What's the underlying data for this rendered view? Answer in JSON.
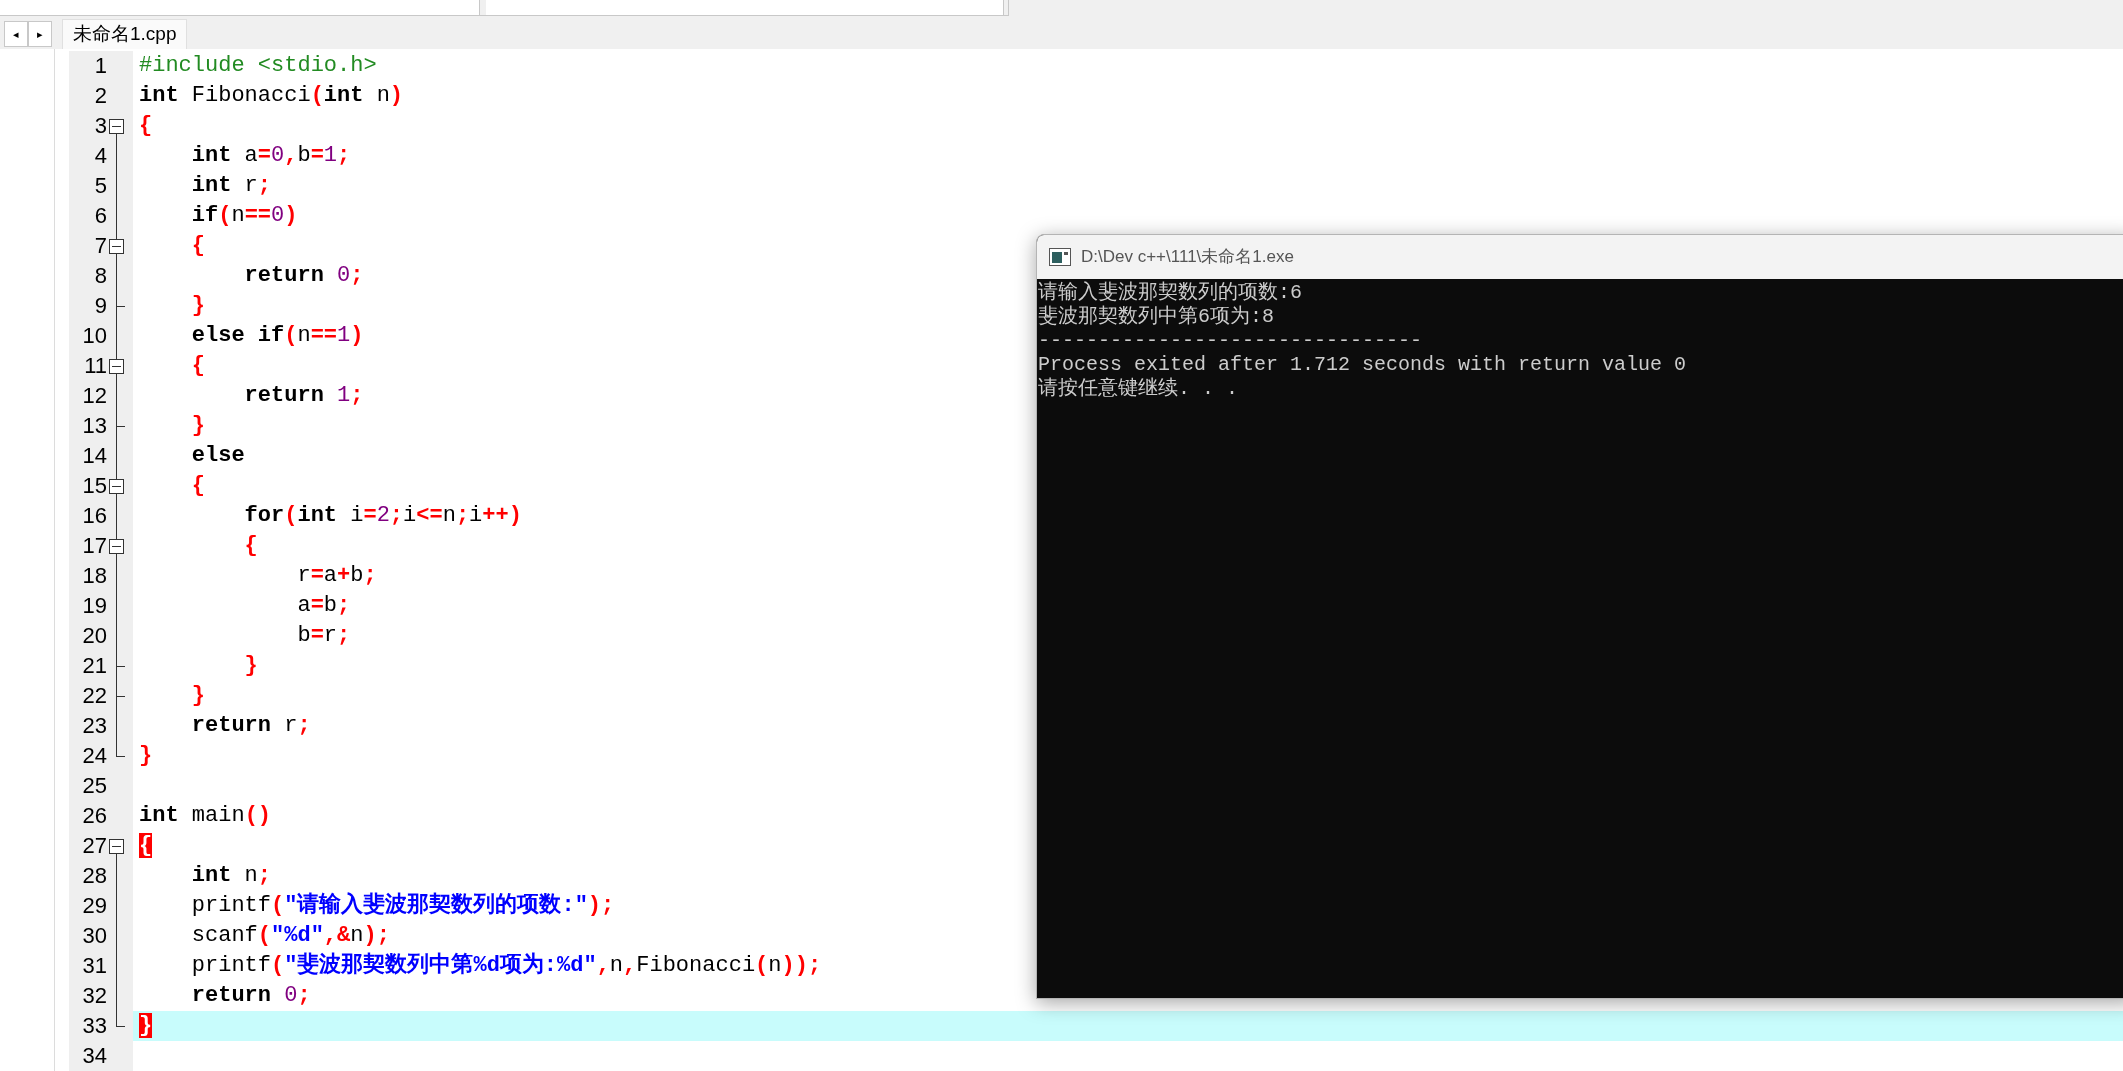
{
  "toolbar": {
    "dropdowns": [
      {
        "kind": "dropdown"
      },
      {
        "kind": "dropdown"
      }
    ]
  },
  "tab_bar": {
    "nav": [
      {
        "text": "◂"
      },
      {
        "text": "▸"
      }
    ],
    "tabs": [
      {
        "label": "未命名1.cpp",
        "selected": true
      }
    ]
  },
  "editor": {
    "lines": [
      {
        "number": "1",
        "current": false,
        "tokens": [
          {
            "kind": "pre",
            "text": "#include <stdio.h>"
          }
        ]
      },
      {
        "number": "2",
        "current": false,
        "tokens": [
          {
            "kind": "kw",
            "text": "int"
          },
          {
            "kind": "id",
            "text": " Fibonacci"
          },
          {
            "kind": "op",
            "text": "("
          },
          {
            "kind": "kw",
            "text": "int"
          },
          {
            "kind": "id",
            "text": " n"
          },
          {
            "kind": "op",
            "text": ")"
          }
        ]
      },
      {
        "number": "3",
        "fold": {
          "kind": "open"
        },
        "current": false,
        "tokens": [
          {
            "kind": "op",
            "text": "{"
          }
        ]
      },
      {
        "number": "4",
        "fold": {
          "kind": "bar"
        },
        "current": false,
        "tokens": [
          {
            "kind": "kw",
            "text": "    int"
          },
          {
            "kind": "id",
            "text": " a"
          },
          {
            "kind": "op",
            "text": "="
          },
          {
            "kind": "num",
            "text": "0"
          },
          {
            "kind": "op",
            "text": ","
          },
          {
            "kind": "id",
            "text": "b"
          },
          {
            "kind": "op",
            "text": "="
          },
          {
            "kind": "num",
            "text": "1"
          },
          {
            "kind": "op",
            "text": ";"
          }
        ]
      },
      {
        "number": "5",
        "fold": {
          "kind": "bar"
        },
        "current": false,
        "tokens": [
          {
            "kind": "kw",
            "text": "    int"
          },
          {
            "kind": "id",
            "text": " r"
          },
          {
            "kind": "op",
            "text": ";"
          }
        ]
      },
      {
        "number": "6",
        "fold": {
          "kind": "bar"
        },
        "current": false,
        "tokens": [
          {
            "kind": "kw",
            "text": "    if"
          },
          {
            "kind": "op",
            "text": "("
          },
          {
            "kind": "id",
            "text": "n"
          },
          {
            "kind": "op",
            "text": "=="
          },
          {
            "kind": "num",
            "text": "0"
          },
          {
            "kind": "op",
            "text": ")"
          }
        ]
      },
      {
        "number": "7",
        "fold": {
          "kind": "open"
        },
        "current": false,
        "tokens": [
          {
            "kind": "op",
            "text": "    {"
          }
        ]
      },
      {
        "number": "8",
        "fold": {
          "kind": "bar"
        },
        "current": false,
        "tokens": [
          {
            "kind": "kw",
            "text": "        return"
          },
          {
            "kind": "num",
            "text": " 0"
          },
          {
            "kind": "op",
            "text": ";"
          }
        ]
      },
      {
        "number": "9",
        "fold": {
          "kind": "tick"
        },
        "current": false,
        "tokens": [
          {
            "kind": "op",
            "text": "    }"
          }
        ]
      },
      {
        "number": "10",
        "fold": {
          "kind": "bar"
        },
        "current": false,
        "tokens": [
          {
            "kind": "kw",
            "text": "    else if"
          },
          {
            "kind": "op",
            "text": "("
          },
          {
            "kind": "id",
            "text": "n"
          },
          {
            "kind": "op",
            "text": "=="
          },
          {
            "kind": "num",
            "text": "1"
          },
          {
            "kind": "op",
            "text": ")"
          }
        ]
      },
      {
        "number": "11",
        "fold": {
          "kind": "open"
        },
        "current": false,
        "tokens": [
          {
            "kind": "op",
            "text": "    {"
          }
        ]
      },
      {
        "number": "12",
        "fold": {
          "kind": "bar"
        },
        "current": false,
        "tokens": [
          {
            "kind": "kw",
            "text": "        return"
          },
          {
            "kind": "num",
            "text": " 1"
          },
          {
            "kind": "op",
            "text": ";"
          }
        ]
      },
      {
        "number": "13",
        "fold": {
          "kind": "tick"
        },
        "current": false,
        "tokens": [
          {
            "kind": "op",
            "text": "    }"
          }
        ]
      },
      {
        "number": "14",
        "fold": {
          "kind": "bar"
        },
        "current": false,
        "tokens": [
          {
            "kind": "kw",
            "text": "    else"
          }
        ]
      },
      {
        "number": "15",
        "fold": {
          "kind": "open"
        },
        "current": false,
        "tokens": [
          {
            "kind": "op",
            "text": "    {"
          }
        ]
      },
      {
        "number": "16",
        "fold": {
          "kind": "bar"
        },
        "current": false,
        "tokens": [
          {
            "kind": "kw",
            "text": "        for"
          },
          {
            "kind": "op",
            "text": "("
          },
          {
            "kind": "kw",
            "text": "int"
          },
          {
            "kind": "id",
            "text": " i"
          },
          {
            "kind": "op",
            "text": "="
          },
          {
            "kind": "num",
            "text": "2"
          },
          {
            "kind": "op",
            "text": ";"
          },
          {
            "kind": "id",
            "text": "i"
          },
          {
            "kind": "op",
            "text": "<="
          },
          {
            "kind": "id",
            "text": "n"
          },
          {
            "kind": "op",
            "text": ";"
          },
          {
            "kind": "id",
            "text": "i"
          },
          {
            "kind": "op",
            "text": "++)"
          }
        ]
      },
      {
        "number": "17",
        "fold": {
          "kind": "open"
        },
        "current": false,
        "tokens": [
          {
            "kind": "op",
            "text": "        {"
          }
        ]
      },
      {
        "number": "18",
        "fold": {
          "kind": "bar"
        },
        "current": false,
        "tokens": [
          {
            "kind": "id",
            "text": "            r"
          },
          {
            "kind": "op",
            "text": "="
          },
          {
            "kind": "id",
            "text": "a"
          },
          {
            "kind": "op",
            "text": "+"
          },
          {
            "kind": "id",
            "text": "b"
          },
          {
            "kind": "op",
            "text": ";"
          }
        ]
      },
      {
        "number": "19",
        "fold": {
          "kind": "bar"
        },
        "current": false,
        "tokens": [
          {
            "kind": "id",
            "text": "            a"
          },
          {
            "kind": "op",
            "text": "="
          },
          {
            "kind": "id",
            "text": "b"
          },
          {
            "kind": "op",
            "text": ";"
          }
        ]
      },
      {
        "number": "20",
        "fold": {
          "kind": "bar"
        },
        "current": false,
        "tokens": [
          {
            "kind": "id",
            "text": "            b"
          },
          {
            "kind": "op",
            "text": "="
          },
          {
            "kind": "id",
            "text": "r"
          },
          {
            "kind": "op",
            "text": ";"
          }
        ]
      },
      {
        "number": "21",
        "fold": {
          "kind": "tick"
        },
        "current": false,
        "tokens": [
          {
            "kind": "op",
            "text": "        }"
          }
        ]
      },
      {
        "number": "22",
        "fold": {
          "kind": "tick"
        },
        "current": false,
        "tokens": [
          {
            "kind": "op",
            "text": "    }"
          }
        ]
      },
      {
        "number": "23",
        "fold": {
          "kind": "bar"
        },
        "current": false,
        "tokens": [
          {
            "kind": "kw",
            "text": "    return"
          },
          {
            "kind": "id",
            "text": " r"
          },
          {
            "kind": "op",
            "text": ";"
          }
        ]
      },
      {
        "number": "24",
        "fold": {
          "kind": "end"
        },
        "current": false,
        "tokens": [
          {
            "kind": "op",
            "text": "}"
          }
        ]
      },
      {
        "number": "25",
        "current": false
      },
      {
        "number": "26",
        "current": false,
        "tokens": [
          {
            "kind": "kw",
            "text": "int"
          },
          {
            "kind": "id",
            "text": " main"
          },
          {
            "kind": "op",
            "text": "()"
          }
        ]
      },
      {
        "number": "27",
        "fold": {
          "kind": "open"
        },
        "current": false,
        "tokens": [
          {
            "kind": "match",
            "text": "{"
          }
        ]
      },
      {
        "number": "28",
        "fold": {
          "kind": "bar"
        },
        "current": false,
        "tokens": [
          {
            "kind": "kw",
            "text": "    int"
          },
          {
            "kind": "id",
            "text": " n"
          },
          {
            "kind": "op",
            "text": ";"
          }
        ]
      },
      {
        "number": "29",
        "fold": {
          "kind": "bar"
        },
        "current": false,
        "tokens": [
          {
            "kind": "id",
            "text": "    printf"
          },
          {
            "kind": "op",
            "text": "("
          },
          {
            "kind": "str",
            "text": "\"请输入斐波那契数列的项数:\""
          },
          {
            "kind": "op",
            "text": ");"
          }
        ]
      },
      {
        "number": "30",
        "fold": {
          "kind": "bar"
        },
        "current": false,
        "tokens": [
          {
            "kind": "id",
            "text": "    scanf"
          },
          {
            "kind": "op",
            "text": "("
          },
          {
            "kind": "str",
            "text": "\"%d\""
          },
          {
            "kind": "op",
            "text": ",&"
          },
          {
            "kind": "id",
            "text": "n"
          },
          {
            "kind": "op",
            "text": ");"
          }
        ]
      },
      {
        "number": "31",
        "fold": {
          "kind": "bar"
        },
        "current": false,
        "tokens": [
          {
            "kind": "id",
            "text": "    printf"
          },
          {
            "kind": "op",
            "text": "("
          },
          {
            "kind": "str",
            "text": "\"斐波那契数列中第%d项为:%d\""
          },
          {
            "kind": "op",
            "text": ","
          },
          {
            "kind": "id",
            "text": "n"
          },
          {
            "kind": "op",
            "text": ","
          },
          {
            "kind": "id",
            "text": "Fibonacci"
          },
          {
            "kind": "op",
            "text": "("
          },
          {
            "kind": "id",
            "text": "n"
          },
          {
            "kind": "op",
            "text": "));"
          }
        ]
      },
      {
        "number": "32",
        "fold": {
          "kind": "bar"
        },
        "current": false,
        "tokens": [
          {
            "kind": "kw",
            "text": "    return"
          },
          {
            "kind": "num",
            "text": " 0"
          },
          {
            "kind": "op",
            "text": ";"
          }
        ]
      },
      {
        "number": "33",
        "fold": {
          "kind": "end"
        },
        "current": true,
        "tokens": [
          {
            "kind": "match",
            "text": "}"
          }
        ]
      },
      {
        "number": "34",
        "current": false
      }
    ]
  },
  "console": {
    "title": "D:\\Dev c++\\111\\未命名1.exe",
    "lines": [
      "请输入斐波那契数列的项数:6",
      "斐波那契数列中第6项为:8",
      "--------------------------------",
      "Process exited after 1.712 seconds with return value 0",
      "请按任意键继续. . ."
    ]
  }
}
